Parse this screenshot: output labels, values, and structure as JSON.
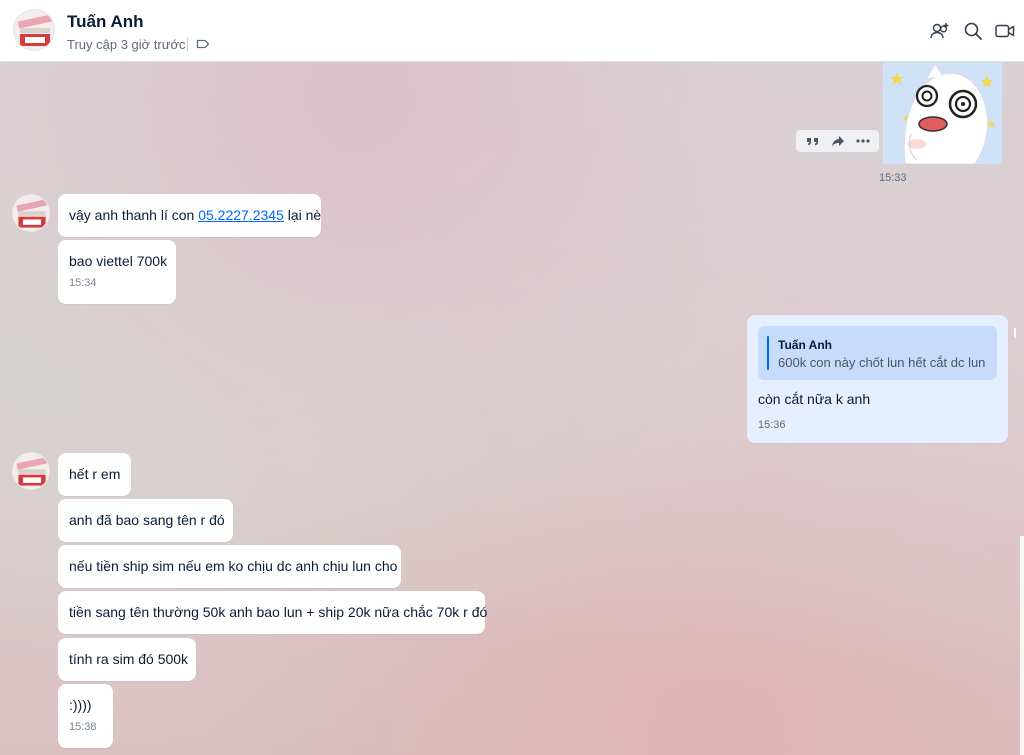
{
  "header": {
    "name": "Tuấn Anh",
    "last_seen": "Truy cập 3 giờ trước"
  },
  "icons": {
    "tag": "tag-icon",
    "add_member": "add-member-icon",
    "search": "search-icon",
    "video_call": "video-call-icon"
  },
  "sticker_message": {
    "time": "15:33",
    "actions": [
      "quote-icon",
      "forward-icon",
      "more-icon"
    ]
  },
  "group1": {
    "messages": [
      {
        "prefix": "vậy anh thanh lí con ",
        "link": "05.2227.2345",
        "suffix": " lại nè"
      },
      {
        "text": "bao viettel 700k",
        "time": "15:34"
      }
    ]
  },
  "mine": {
    "quote_author": "Tuấn Anh",
    "quote_text": "600k con này chốt lun hết cắt dc lun",
    "text": "còn cắt nữa k anh",
    "time": "15:36"
  },
  "group2": {
    "messages": [
      {
        "text": "hết r em"
      },
      {
        "text": "anh đã bao sang tên r đó"
      },
      {
        "text": "nếu tiền ship sim nếu em ko chịu dc anh chịu lun cho"
      },
      {
        "text": "tiền sang tên thường 50k anh bao lun + ship 20k nữa chắc 70k r đó"
      },
      {
        "text": "tính ra sim đó 500k"
      },
      {
        "text": ":))))",
        "time": "15:38"
      }
    ]
  },
  "colors": {
    "accent": "#0068ff",
    "my_bubble": "#e5efff",
    "quote_bg": "#c7dcfb",
    "their_bubble": "#ffffff"
  }
}
